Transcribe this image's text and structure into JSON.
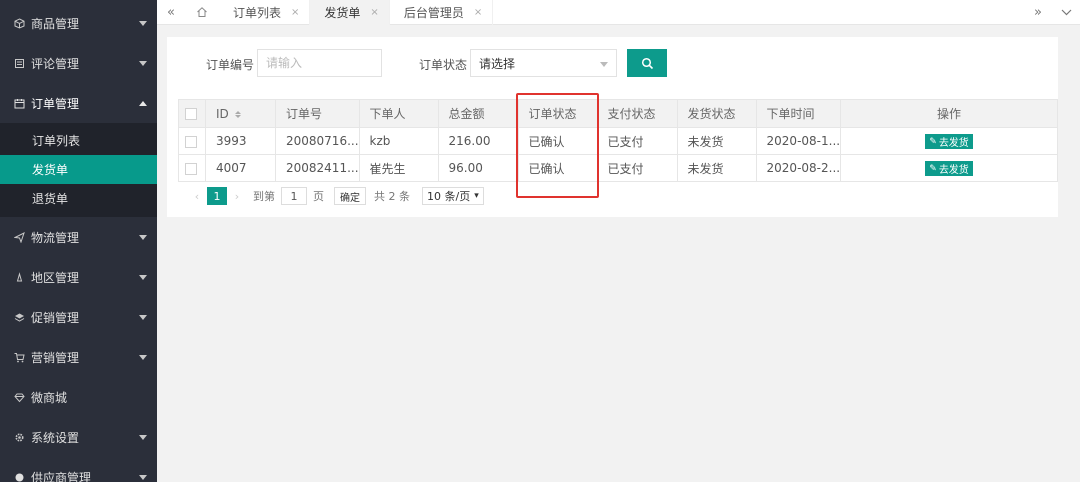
{
  "sidebar": {
    "groups": [
      {
        "label": "商品管理",
        "icon": "cube-icon"
      },
      {
        "label": "评论管理",
        "icon": "comment-icon"
      },
      {
        "label": "订单管理",
        "icon": "calendar-icon",
        "expanded": true
      },
      {
        "label": "物流管理",
        "icon": "paper-plane-icon"
      },
      {
        "label": "地区管理",
        "icon": "location-icon"
      },
      {
        "label": "促销管理",
        "icon": "layers-icon"
      },
      {
        "label": "营销管理",
        "icon": "cart-icon"
      },
      {
        "label": "微商城",
        "icon": "diamond-icon"
      },
      {
        "label": "系统设置",
        "icon": "gear-icon"
      },
      {
        "label": "供应商管理",
        "icon": "circle-icon"
      }
    ],
    "sub_items": [
      {
        "label": "订单列表"
      },
      {
        "label": "发货单",
        "active": true
      },
      {
        "label": "退货单"
      }
    ]
  },
  "tabs": [
    {
      "label": "订单列表"
    },
    {
      "label": "发货单",
      "active": true
    },
    {
      "label": "后台管理员"
    }
  ],
  "tab_close_symbol": "×",
  "filter": {
    "order_no_label": "订单编号",
    "order_no_placeholder": "请输入",
    "status_label": "订单状态",
    "status_value": "请选择"
  },
  "table": {
    "headers": [
      "ID",
      "订单号",
      "下单人",
      "总金额",
      "订单状态",
      "支付状态",
      "发货状态",
      "下单时间",
      "操作"
    ],
    "rows": [
      {
        "id": "3993",
        "order_no": "20080716...",
        "buyer": "kzb",
        "amount": "216.00",
        "status": "已确认",
        "pay": "已支付",
        "ship": "未发货",
        "time": "2020-08-1...",
        "action": "去发货"
      },
      {
        "id": "4007",
        "order_no": "20082411...",
        "buyer": "崔先生",
        "amount": "96.00",
        "status": "已确认",
        "pay": "已支付",
        "ship": "未发货",
        "time": "2020-08-2...",
        "action": "去发货"
      }
    ]
  },
  "pager": {
    "current": "1",
    "goto_prefix": "到第",
    "goto_value": "1",
    "goto_suffix": "页",
    "confirm": "确定",
    "total": "共 2 条",
    "page_size": "10 条/页"
  },
  "colors": {
    "sidebar_bg": "#2b2f3a",
    "accent": "#0d9b8c",
    "highlight": "#e0332e"
  }
}
